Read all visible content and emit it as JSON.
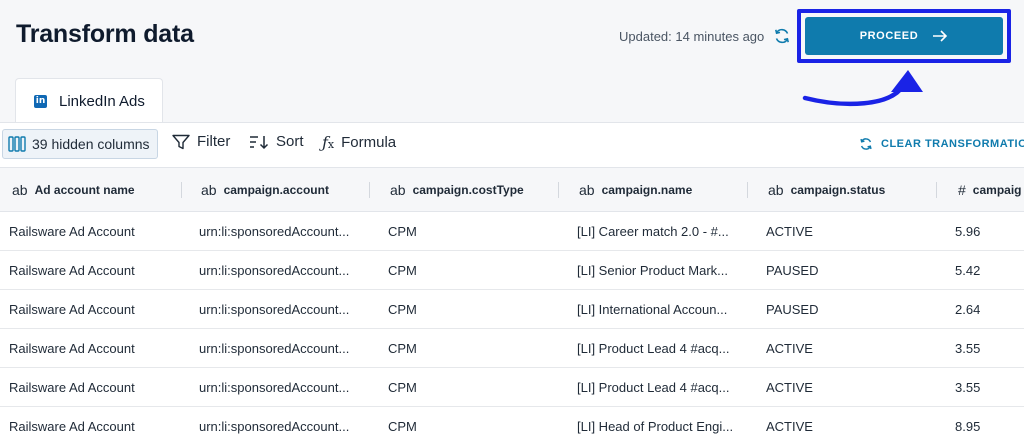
{
  "header": {
    "title": "Transform data",
    "updated": "Updated: 14 minutes ago",
    "proceed_label": "PROCEED"
  },
  "tabs": [
    {
      "label": "LinkedIn Ads",
      "icon": "linkedin-icon"
    }
  ],
  "toolbar": {
    "hidden_columns": "39 hidden columns",
    "filter": "Filter",
    "sort": "Sort",
    "formula": "Formula",
    "clear": "CLEAR TRANSFORMATIONS"
  },
  "table": {
    "columns": [
      {
        "type": "ab",
        "name": "Ad account name"
      },
      {
        "type": "ab",
        "name": "campaign.account"
      },
      {
        "type": "ab",
        "name": "campaign.costType"
      },
      {
        "type": "ab",
        "name": "campaign.name"
      },
      {
        "type": "ab",
        "name": "campaign.status"
      },
      {
        "type": "#",
        "name": "campaig"
      }
    ],
    "rows": [
      [
        "Railsware Ad Account",
        "urn:li:sponsoredAccount...",
        "CPM",
        "[LI] Career match 2.0 - #...",
        "ACTIVE",
        "5.96"
      ],
      [
        "Railsware Ad Account",
        "urn:li:sponsoredAccount...",
        "CPM",
        "[LI] Senior Product Mark...",
        "PAUSED",
        "5.42"
      ],
      [
        "Railsware Ad Account",
        "urn:li:sponsoredAccount...",
        "CPM",
        "[LI] International Accoun...",
        "PAUSED",
        "2.64"
      ],
      [
        "Railsware Ad Account",
        "urn:li:sponsoredAccount...",
        "CPM",
        "[LI] Product Lead 4 #acq...",
        "ACTIVE",
        "3.55"
      ],
      [
        "Railsware Ad Account",
        "urn:li:sponsoredAccount...",
        "CPM",
        "[LI] Product Lead 4 #acq...",
        "ACTIVE",
        "3.55"
      ],
      [
        "Railsware Ad Account",
        "urn:li:sponsoredAccount...",
        "CPM",
        "[LI] Head of Product Engi...",
        "ACTIVE",
        "8.95"
      ]
    ]
  },
  "colors": {
    "accent": "#0f7bad",
    "highlight": "#1a23e6",
    "linkedin": "#0f68b4"
  }
}
